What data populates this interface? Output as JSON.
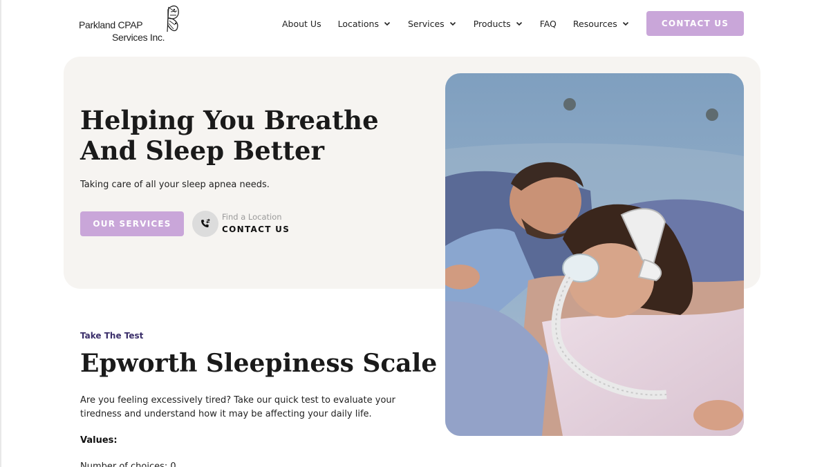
{
  "brand": {
    "line1": "Parkland CPAP",
    "line2": "Services Inc."
  },
  "nav": {
    "items": [
      {
        "label": "About Us",
        "has_dropdown": false
      },
      {
        "label": "Locations",
        "has_dropdown": true
      },
      {
        "label": "Services",
        "has_dropdown": true
      },
      {
        "label": "Products",
        "has_dropdown": true
      },
      {
        "label": "FAQ",
        "has_dropdown": false
      },
      {
        "label": "Resources",
        "has_dropdown": true
      }
    ],
    "cta_label": "CONTACT US"
  },
  "hero": {
    "title": "Helping You Breathe And Sleep Better",
    "subtitle": "Taking care of all your sleep apnea needs.",
    "primary_button": "OUR SERVICES",
    "find_location": "Find a Location",
    "contact_link": "CONTACT US",
    "image_icon": "couple-sleeping-cpap-photo"
  },
  "test": {
    "eyebrow": "Take The Test",
    "title": "Epworth Sleepiness Scale",
    "description": "Are you feeling excessively tired? Take our quick test to evaluate your tiredness and understand how it may be affecting your daily life.",
    "values_label": "Values:",
    "partial_line": "Number of choices: 0"
  },
  "colors": {
    "accent": "#c9a6d9",
    "hero_bg": "#f6f4f1",
    "eyebrow": "#3a2e6a"
  }
}
